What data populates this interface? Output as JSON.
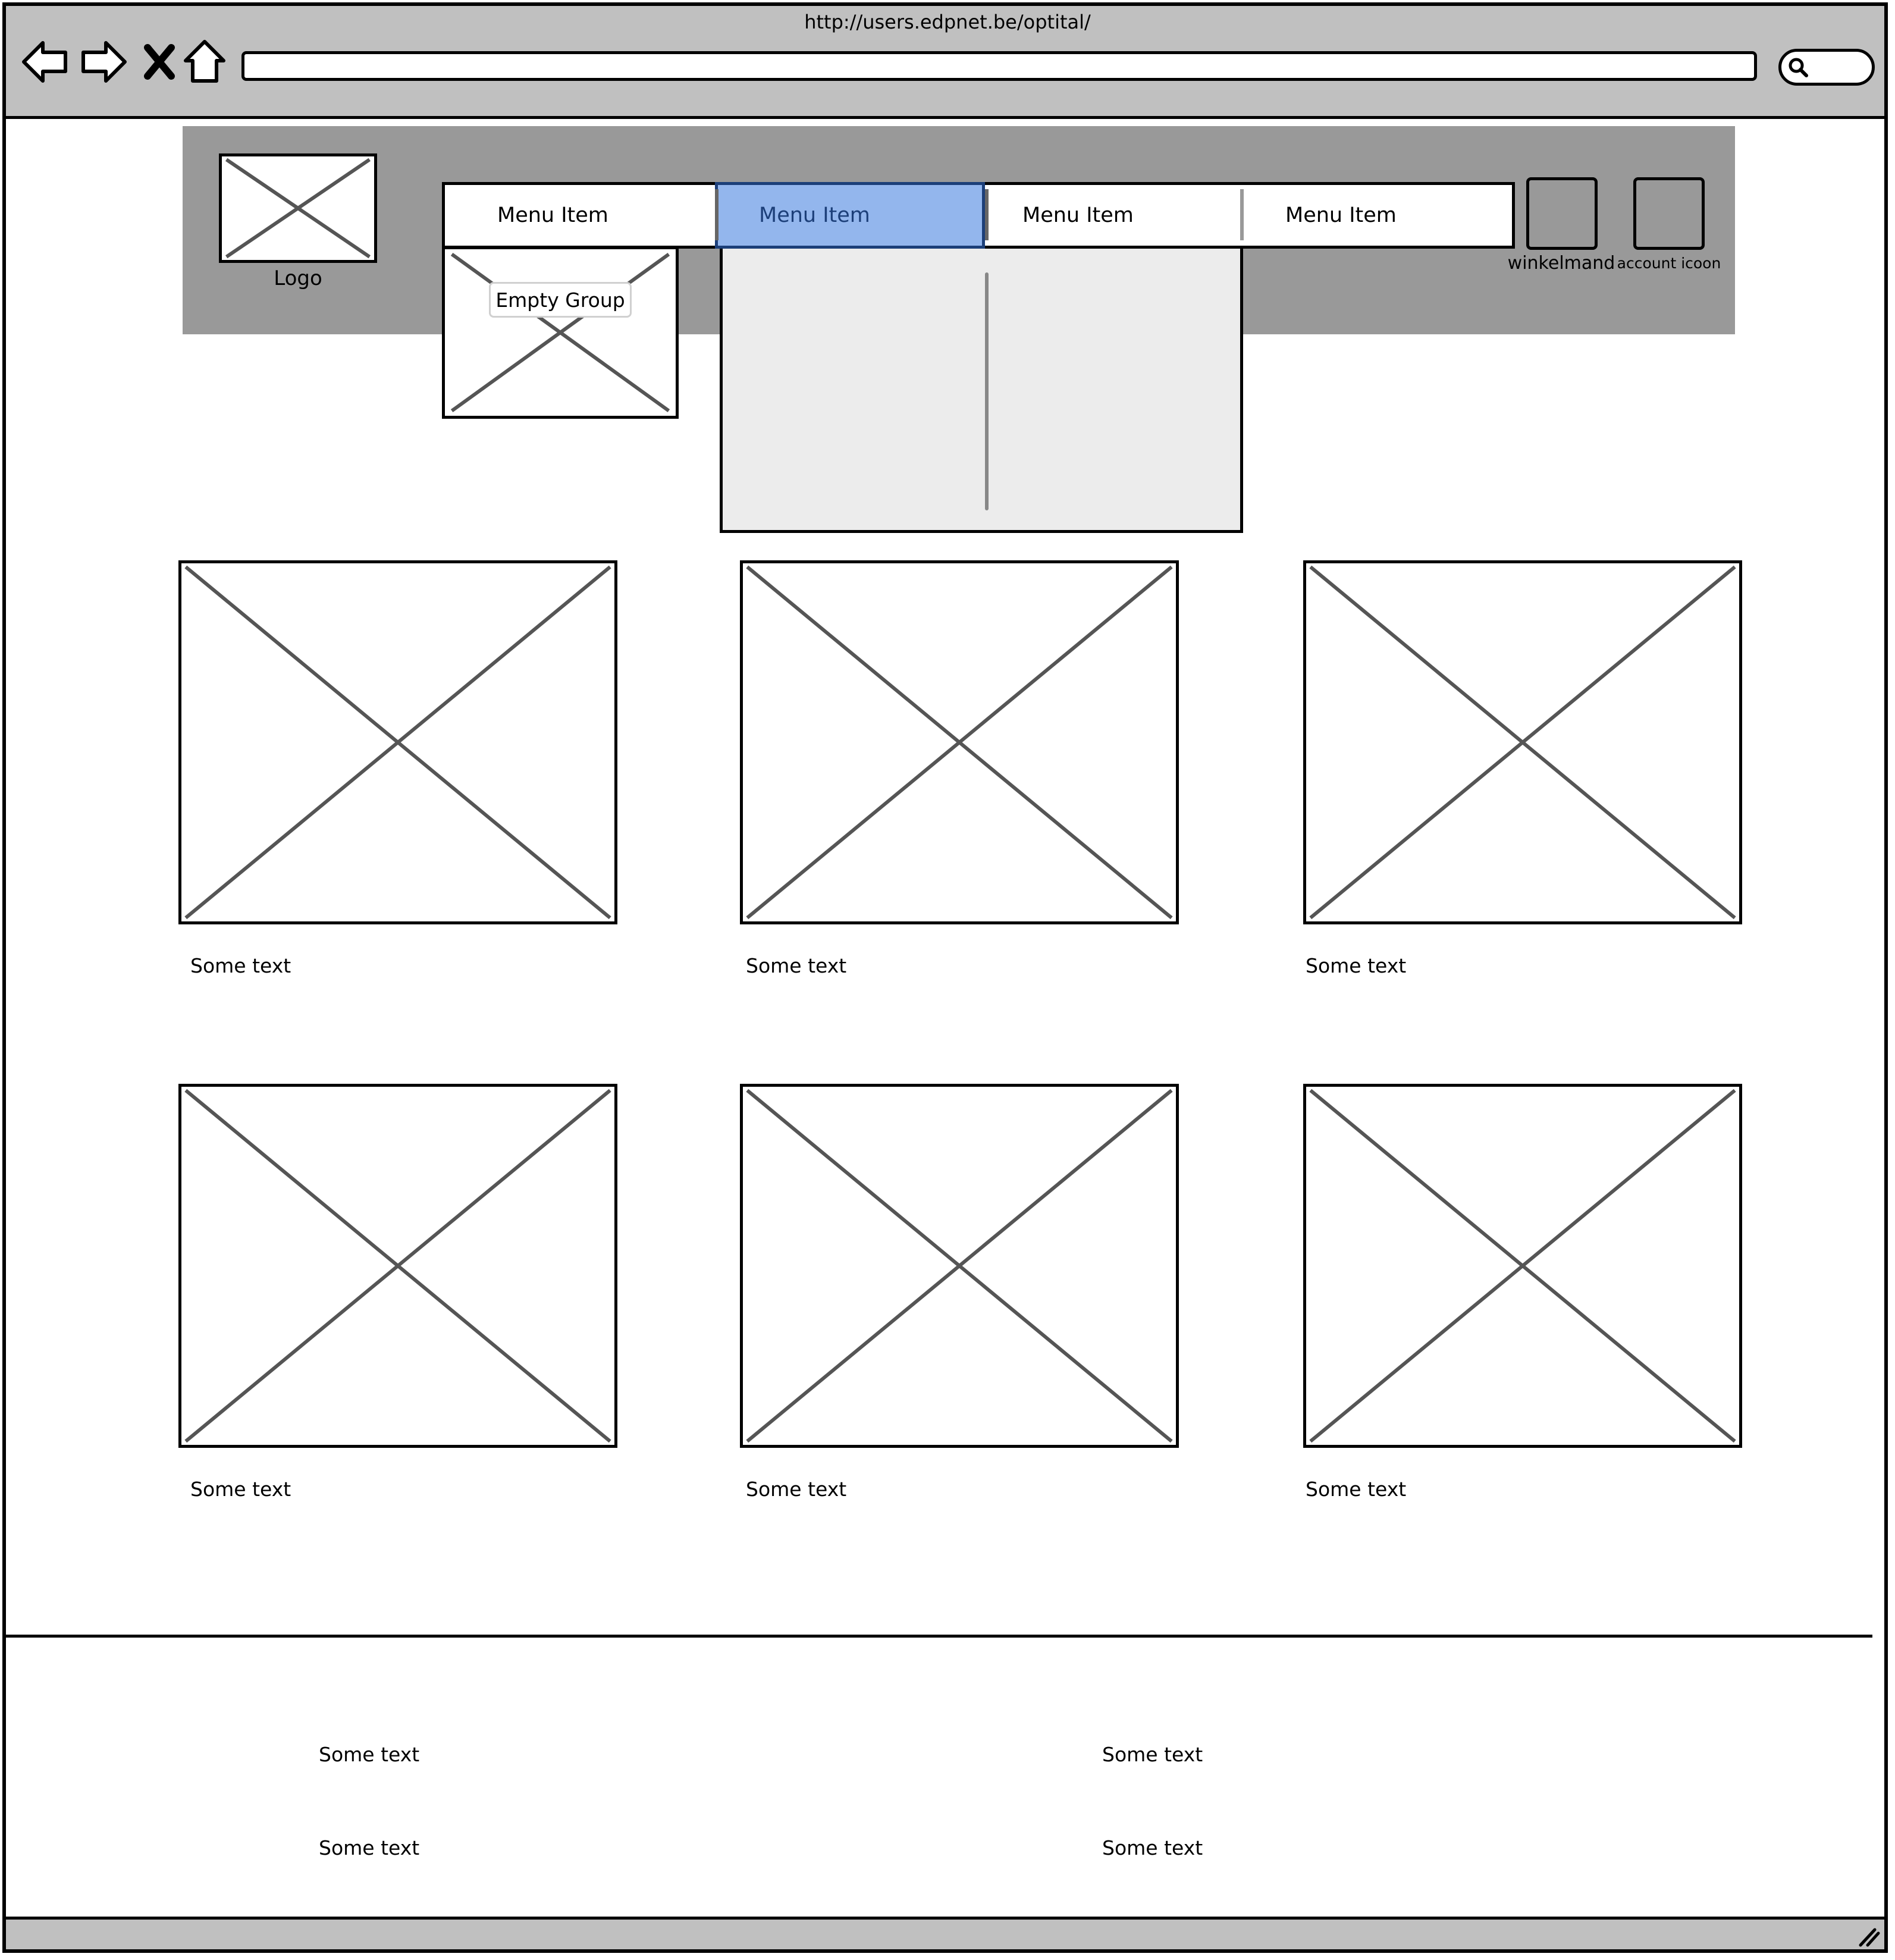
{
  "browser": {
    "url": "http://users.edpnet.be/optital/",
    "address_value": ""
  },
  "icons": {
    "back": "back-arrow-icon",
    "forward": "forward-arrow-icon",
    "stop": "close-icon",
    "home": "home-icon",
    "search": "search-icon",
    "resize": "resize-grip-icon"
  },
  "header": {
    "logo_label": "Logo",
    "menu": [
      {
        "label": "Menu Item",
        "selected": false
      },
      {
        "label": "Menu Item",
        "selected": true
      },
      {
        "label": "Menu Item",
        "selected": false
      },
      {
        "label": "Menu Item",
        "selected": false
      }
    ],
    "empty_group_label": "Empty Group",
    "cart_label": "winkelmand",
    "account_label": "account icoon"
  },
  "products": {
    "row1": [
      "Some text",
      "Some text",
      "Some text"
    ],
    "row2": [
      "Some text",
      "Some text",
      "Some text"
    ]
  },
  "footer": {
    "left": [
      "Some text",
      "Some text"
    ],
    "right": [
      "Some text",
      "Some text"
    ]
  },
  "colors": {
    "chrome": "#c0c0c0",
    "header_band": "#999999",
    "menu_selected": "#93b6ed",
    "dropdown": "#ececec"
  }
}
